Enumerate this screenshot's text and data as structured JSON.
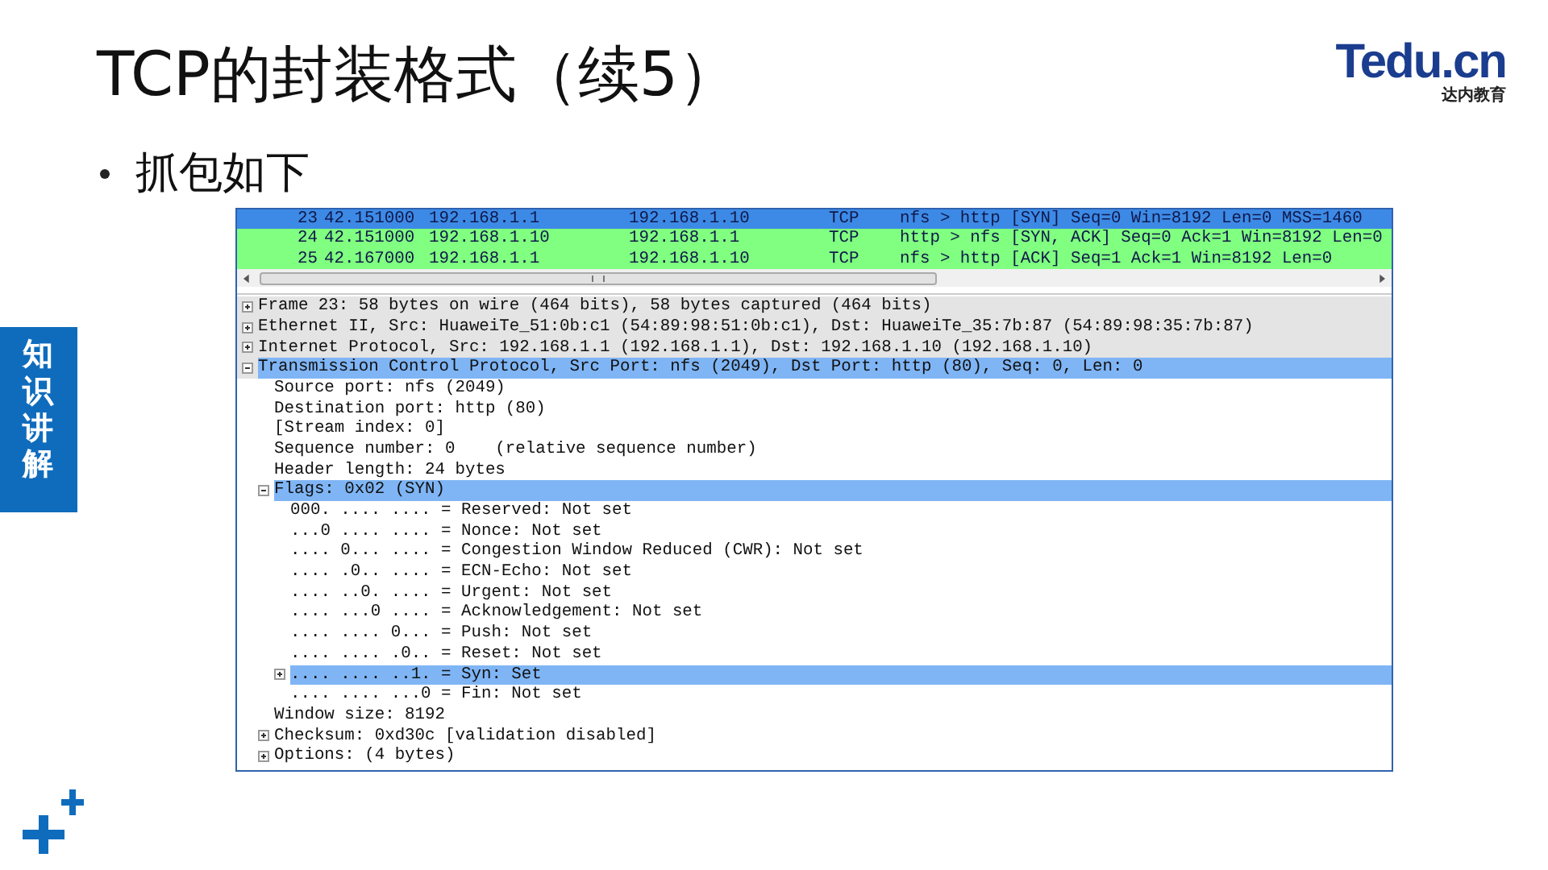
{
  "title": "TCP的封装格式（续5）",
  "logo": {
    "brand": "Tedu.cn",
    "subtitle": "达内教育"
  },
  "bullets": [
    "抓包如下"
  ],
  "side_tab": {
    "label": "知识讲解"
  },
  "packet_list": {
    "rows": [
      {
        "no": "23",
        "time": "42.151000",
        "source": "192.168.1.1",
        "destination": "192.168.1.10",
        "protocol": "TCP",
        "info": "nfs > http [SYN] Seq=0 Win=8192 Len=0 MSS=1460",
        "selected": true
      },
      {
        "no": "24",
        "time": "42.151000",
        "source": "192.168.1.10",
        "destination": "192.168.1.1",
        "protocol": "TCP",
        "info": "http > nfs [SYN, ACK] Seq=0 Ack=1 Win=8192 Len=0",
        "selected": false,
        "color": "#80ff80"
      },
      {
        "no": "25",
        "time": "42.167000",
        "source": "192.168.1.1",
        "destination": "192.168.1.10",
        "protocol": "TCP",
        "info": "nfs > http [ACK] Seq=1 Ack=1 Win=8192 Len=0",
        "selected": false,
        "color": "#80ff80"
      }
    ]
  },
  "details": [
    {
      "text": "Frame 23: 58 bytes on wire (464 bits), 58 bytes captured (464 bits)",
      "expanded": false,
      "selected": false
    },
    {
      "text": "Ethernet II, Src: HuaweiTe_51:0b:c1 (54:89:98:51:0b:c1), Dst: HuaweiTe_35:7b:87 (54:89:98:35:7b:87)",
      "expanded": false,
      "selected": false
    },
    {
      "text": "Internet Protocol, Src: 192.168.1.1 (192.168.1.1), Dst: 192.168.1.10 (192.168.1.10)",
      "expanded": false,
      "selected": false
    },
    {
      "text": "Transmission Control Protocol, Src Port: nfs (2049), Dst Port: http (80), Seq: 0, Len: 0",
      "expanded": true,
      "selected": true,
      "children": [
        {
          "text": "Source port: nfs (2049)",
          "selected": false
        },
        {
          "text": "Destination port: http (80)",
          "selected": false
        },
        {
          "text": "[Stream index: 0]",
          "selected": false
        },
        {
          "text": "Sequence number: 0    (relative sequence number)",
          "selected": false
        },
        {
          "text": "Header length: 24 bytes",
          "selected": false
        },
        {
          "text": "Flags: 0x02 (SYN)",
          "expanded": true,
          "selected": true,
          "children": [
            {
              "text": "000. .... .... = Reserved: Not set",
              "selected": false
            },
            {
              "text": "...0 .... .... = Nonce: Not set",
              "selected": false
            },
            {
              "text": ".... 0... .... = Congestion Window Reduced (CWR): Not set",
              "selected": false
            },
            {
              "text": ".... .0.. .... = ECN-Echo: Not set",
              "selected": false
            },
            {
              "text": ".... ..0. .... = Urgent: Not set",
              "selected": false
            },
            {
              "text": ".... ...0 .... = Acknowledgement: Not set",
              "selected": false
            },
            {
              "text": ".... .... 0... = Push: Not set",
              "selected": false
            },
            {
              "text": ".... .... .0.. = Reset: Not set",
              "selected": false
            },
            {
              "text": ".... .... ..1. = Syn: Set",
              "expanded": false,
              "selected": true
            },
            {
              "text": ".... .... ...0 = Fin: Not set",
              "selected": false
            }
          ]
        },
        {
          "text": "Window size: 8192",
          "selected": false
        },
        {
          "text": "Checksum: 0xd30c [validation disabled]",
          "expanded": false,
          "selected": false
        },
        {
          "text": "Options: (4 bytes)",
          "expanded": false,
          "selected": false
        }
      ]
    }
  ]
}
